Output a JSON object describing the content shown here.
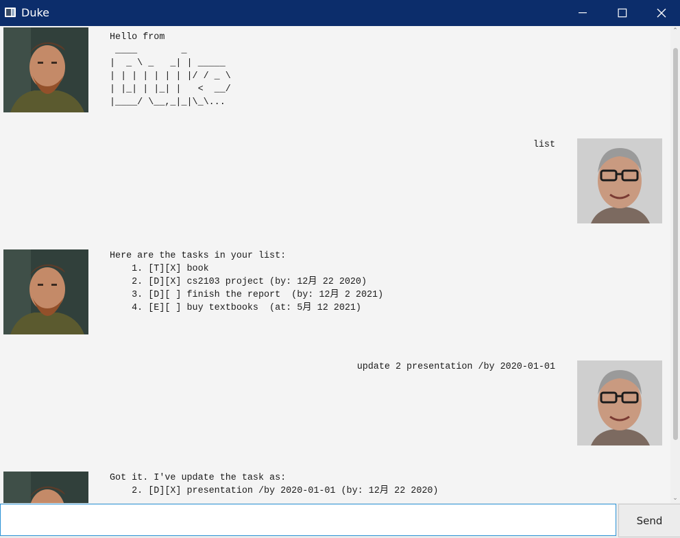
{
  "window": {
    "title": "Duke"
  },
  "messages": [
    {
      "sender": "duke",
      "text": "Hello from\n ____        _\n|  _ \\ _   _| | _____\n| | | | | | | |/ / _ \\\n| |_| | |_| |   <  __/\n|____/ \\__,_|_|\\_\\..."
    },
    {
      "sender": "user",
      "text": "list"
    },
    {
      "sender": "duke",
      "text": "Here are the tasks in your list:\n    1. [T][X] book\n    2. [D][X] cs2103 project (by: 12月 22 2020)\n    3. [D][ ] finish the report  (by: 12月 2 2021)\n    4. [E][ ] buy textbooks  (at: 5月 12 2021)"
    },
    {
      "sender": "user",
      "text": "update 2 presentation /by 2020-01-01"
    },
    {
      "sender": "duke",
      "text": "Got it. I've update the task as:\n    2. [D][X] presentation /by 2020-01-01 (by: 12月 22 2020)"
    }
  ],
  "input": {
    "value": "",
    "placeholder": ""
  },
  "send_label": "Send",
  "colors": {
    "titlebar": "#0c2d6b",
    "background": "#f4f4f4",
    "input_border": "#2a92d6"
  }
}
